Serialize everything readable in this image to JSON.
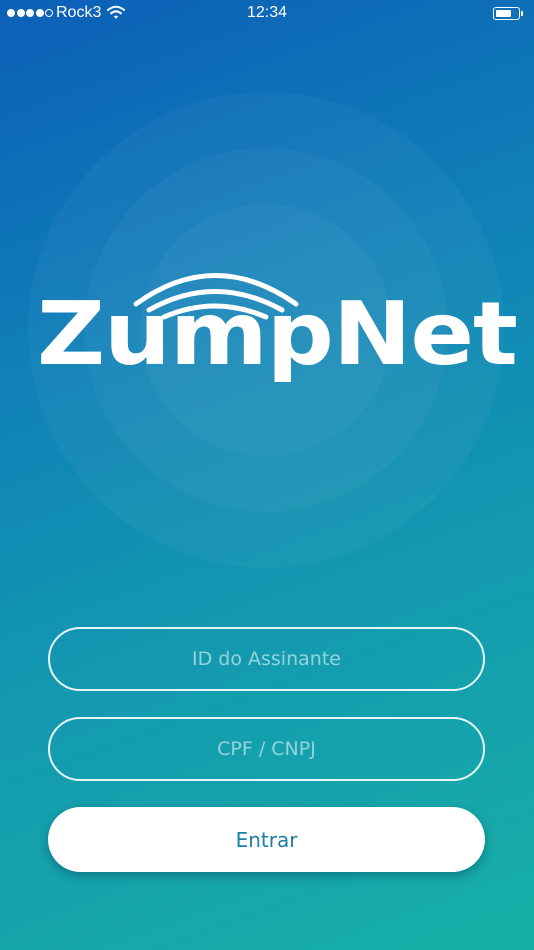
{
  "status_bar": {
    "signal_bars_filled": 4,
    "signal_bars_total": 5,
    "carrier": "Rock3",
    "time": "12:34",
    "icons": [
      "signal-dots",
      "wifi-icon",
      "battery-icon"
    ]
  },
  "logo": {
    "text": "ZumpNet",
    "icon": "wifi-arcs"
  },
  "form": {
    "subscriber_id_placeholder": "ID do Assinante",
    "subscriber_id_value": "",
    "document_placeholder": "CPF / CNPJ",
    "document_value": "",
    "submit_label": "Entrar"
  },
  "colors": {
    "gradient_top": "#0c5fb8",
    "gradient_bottom": "#17b0a6",
    "button_text": "#1b7ea6",
    "foreground": "#ffffff"
  }
}
